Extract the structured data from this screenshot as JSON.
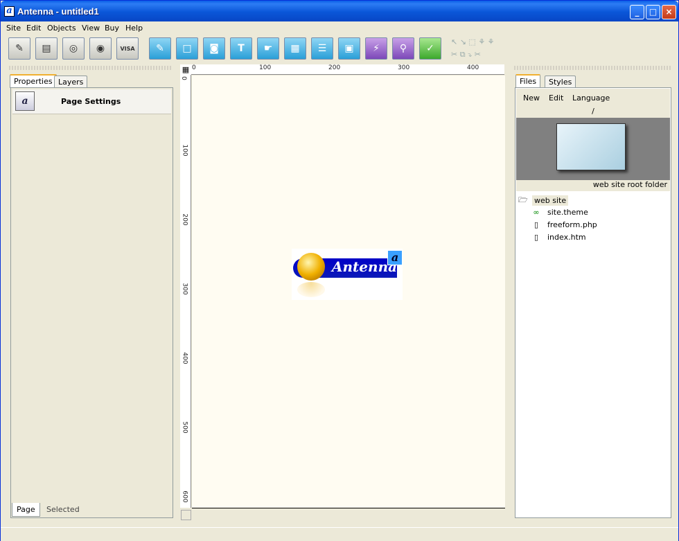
{
  "window": {
    "title": "Antenna - untitled1",
    "app_icon": "a"
  },
  "title_buttons": {
    "minimize": "_",
    "maximize": "□",
    "close": "×"
  },
  "menu": [
    "Site",
    "Edit",
    "Objects",
    "View",
    "Buy",
    "Help"
  ],
  "toolbar": {
    "tools": [
      {
        "name": "open-site-icon",
        "glyph": "✎"
      },
      {
        "name": "save-icon",
        "glyph": "▤"
      },
      {
        "name": "publish-icon",
        "glyph": "◎"
      },
      {
        "name": "preview-icon",
        "glyph": "◉"
      },
      {
        "name": "visa-card-icon",
        "glyph": "VISA"
      },
      {
        "name": "edit-page-icon",
        "glyph": "✎"
      },
      {
        "name": "rectangle-icon",
        "glyph": "□"
      },
      {
        "name": "image-icon",
        "glyph": "◙"
      },
      {
        "name": "text-icon",
        "glyph": "T"
      },
      {
        "name": "link-icon",
        "glyph": "☛"
      },
      {
        "name": "layers-icon",
        "glyph": "▦"
      },
      {
        "name": "align-icon",
        "glyph": "☰"
      },
      {
        "name": "media-icon",
        "glyph": "▣"
      },
      {
        "name": "flash-icon",
        "glyph": "⚡"
      },
      {
        "name": "zoom-icon",
        "glyph": "⚲"
      },
      {
        "name": "check-icon",
        "glyph": "✓"
      }
    ]
  },
  "left_panel": {
    "tabs": [
      "Properties",
      "Layers"
    ],
    "header_title": "Page Settings",
    "header_icon": "a",
    "bottom_tabs": [
      "Page",
      "Selected"
    ]
  },
  "ruler": {
    "top": [
      "0",
      "100",
      "200",
      "300",
      "400"
    ],
    "left": [
      "0",
      "100",
      "200",
      "300",
      "400",
      "500",
      "600"
    ]
  },
  "logo": {
    "text": "Antenna",
    "badge": "a"
  },
  "right_panel": {
    "tabs": [
      "Files",
      "Styles"
    ],
    "menu": [
      "New",
      "Edit",
      "Language"
    ],
    "path": "/",
    "root_label": "web site root folder",
    "tree": [
      {
        "label": "web site",
        "icon": "folder-open-icon",
        "glyph": "🗁"
      },
      {
        "label": "site.theme",
        "icon": "theme-icon",
        "glyph": "∞"
      },
      {
        "label": "freeform.php",
        "icon": "document-icon",
        "glyph": "▯"
      },
      {
        "label": "index.htm",
        "icon": "document-icon",
        "glyph": "▯"
      }
    ]
  }
}
